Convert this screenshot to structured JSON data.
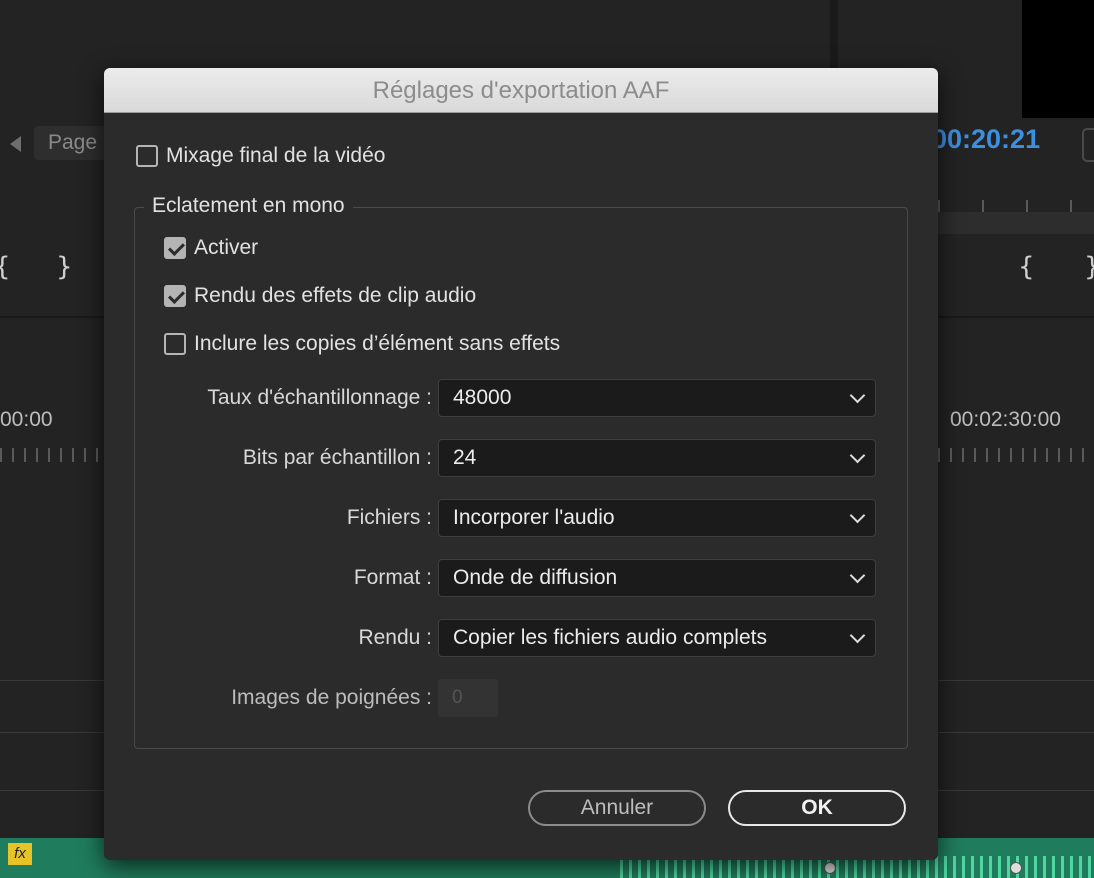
{
  "background": {
    "page_button_label": "Page",
    "timecode": "00:20:21",
    "timecode_color": "#3d8fe0",
    "timeline_start": "00:00",
    "timeline_marker": "00:02:30:00",
    "fx_label": "fx"
  },
  "dialog": {
    "title": "Réglages d'exportation AAF",
    "mixdown_label": "Mixage final de la vidéo",
    "mixdown_checked": false,
    "group_title": "Eclatement en mono",
    "activate_label": "Activer",
    "activate_checked": true,
    "render_effects_label": "Rendu des effets de clip audio",
    "render_effects_checked": true,
    "include_copies_label": "Inclure les copies d’élément sans effets",
    "include_copies_checked": false,
    "sample_rate_label": "Taux d'échantillonnage :",
    "sample_rate_value": "48000",
    "bits_label": "Bits par échantillon :",
    "bits_value": "24",
    "files_label": "Fichiers :",
    "files_value": "Incorporer l'audio",
    "format_label": "Format :",
    "format_value": "Onde de diffusion",
    "render_label": "Rendu :",
    "render_value": "Copier les fichiers audio complets",
    "handles_label": "Images de poignées :",
    "handles_value": "0",
    "cancel_label": "Annuler",
    "ok_label": "OK"
  }
}
